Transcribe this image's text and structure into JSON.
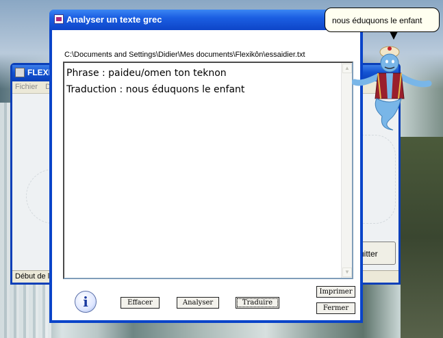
{
  "background_window": {
    "title": "FLEXI",
    "menu": [
      "Fichier",
      "D"
    ],
    "status": "Début de l'",
    "quit_label": "uitter"
  },
  "dialog": {
    "title": "Analyser un texte grec",
    "path": "C:\\Documents and Settings\\Didier\\Mes documents\\Flexikôn\\essaidier.txt",
    "lines": [
      "Phrase : paideu/omen ton teknon",
      "Traduction : nous éduquons le enfant"
    ],
    "buttons": {
      "effacer": "Effacer",
      "analyser": "Analyser",
      "traduire": "Traduire",
      "imprimer": "Imprimer",
      "fermer": "Fermer"
    }
  },
  "assistant": {
    "bubble_text": "nous éduquons le enfant"
  },
  "icons": {
    "info": "info-icon",
    "window": "app-window-icon",
    "genie": "genie-assistant-icon"
  },
  "colors": {
    "titlebar": "#0d45c8",
    "dialog_bg": "#ffffff",
    "button_face": "#f3f2ec"
  }
}
